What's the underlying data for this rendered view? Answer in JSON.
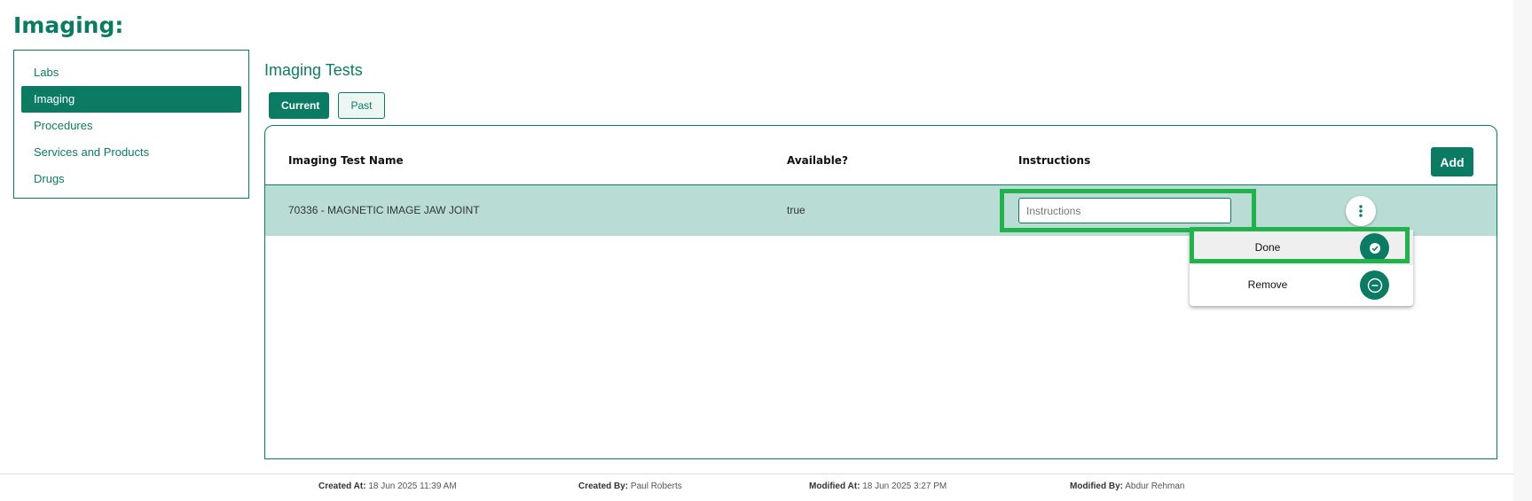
{
  "page": {
    "title": "Imaging:"
  },
  "sidebar": {
    "items": [
      {
        "label": "Labs",
        "active": false
      },
      {
        "label": "Imaging",
        "active": true
      },
      {
        "label": "Procedures",
        "active": false
      },
      {
        "label": "Services and Products",
        "active": false
      },
      {
        "label": "Drugs",
        "active": false
      }
    ]
  },
  "main": {
    "section_title": "Imaging Tests",
    "tabs": [
      {
        "label": "Current",
        "active": true
      },
      {
        "label": "Past",
        "active": false
      }
    ],
    "table": {
      "columns": [
        "Imaging Test Name",
        "Available?",
        "Instructions"
      ],
      "add_label": "Add",
      "rows": [
        {
          "name": "70336 - MAGNETIC IMAGE JAW JOINT",
          "available": "true",
          "instructions_value": "",
          "instructions_placeholder": "Instructions"
        }
      ]
    },
    "row_menu": {
      "items": [
        {
          "label": "Done",
          "icon": "check-circle-icon"
        },
        {
          "label": "Remove",
          "icon": "minus-circle-icon"
        }
      ]
    }
  },
  "footer": {
    "created_at_label": "Created At:",
    "created_at": "18 Jun 2025 11:39 AM",
    "created_by_label": "Created By:",
    "created_by": "Paul Roberts",
    "modified_at_label": "Modified At:",
    "modified_at": "18 Jun 2025 3:27 PM",
    "modified_by_label": "Modified By:",
    "modified_by": "Abdur Rehman"
  },
  "colors": {
    "accent": "#0b7c63",
    "row_selected": "#b9ddd5",
    "highlight": "#22b24c"
  }
}
